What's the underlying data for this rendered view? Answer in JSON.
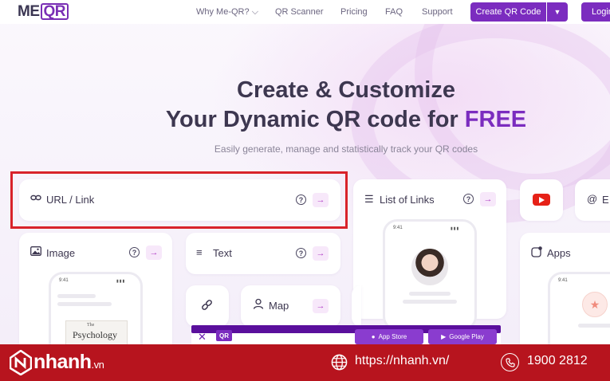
{
  "nav": {
    "logo": {
      "me": "ME",
      "qr": "QR"
    },
    "links": [
      "Why Me-QR?",
      "QR Scanner",
      "Pricing",
      "FAQ",
      "Support"
    ],
    "create_button": "Create QR Code",
    "login_button": "Login"
  },
  "hero": {
    "title_line1": "Create & Customize",
    "title_line2_prefix": "Your Dynamic QR code for",
    "title_line2_highlight": "FREE",
    "subtitle": "Easily generate, manage and statistically track your QR codes"
  },
  "cards": {
    "url": {
      "label": "URL / Link"
    },
    "list_of_links": {
      "label": "List of Links"
    },
    "email": {
      "label": "E"
    },
    "image": {
      "label": "Image"
    },
    "text": {
      "label": "Text"
    },
    "map": {
      "label": "Map"
    },
    "apps": {
      "label": "Apps"
    },
    "help_glyph": "?",
    "arrow_glyph": "→"
  },
  "phones": {
    "time": "9:41",
    "book_title_small": "The",
    "book_title": "Psychology"
  },
  "promo": {
    "qr": "QR",
    "app_store": "App Store",
    "google_play": "Google Play"
  },
  "footer": {
    "brand": "nhanh",
    "tld": ".vn",
    "url": "https://nhanh.vn/",
    "phone": "1900 2812"
  },
  "colors": {
    "accent": "#7b2cbf",
    "footer": "#b7141e",
    "highlight": "#d8232a"
  }
}
